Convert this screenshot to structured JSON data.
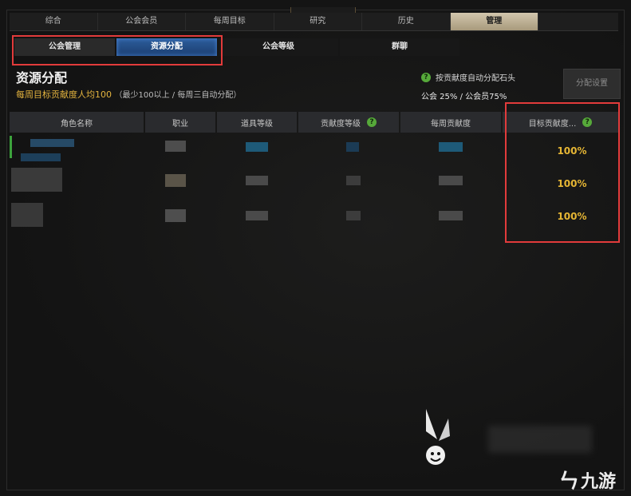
{
  "main_tabs": [
    {
      "label": "综合",
      "active": false
    },
    {
      "label": "公会会员",
      "active": false
    },
    {
      "label": "每周目标",
      "active": false
    },
    {
      "label": "研究",
      "active": false
    },
    {
      "label": "历史",
      "active": false
    },
    {
      "label": "管理",
      "active": true
    }
  ],
  "sub_tabs": [
    {
      "label": "公会管理",
      "active": false
    },
    {
      "label": "资源分配",
      "active": true
    },
    {
      "label": "公会等级",
      "active": false
    },
    {
      "label": "群聊",
      "active": false
    }
  ],
  "section": {
    "title": "资源分配",
    "subtitle": "每周目标贡献度人均100",
    "rule": "（最少100以上 / 每周三自动分配）"
  },
  "auto_distribute": {
    "label": "按贡献度自动分配石头",
    "guild_share": "公会 25%",
    "member_share": "公会员75%"
  },
  "allocate_button": "分配设置",
  "table": {
    "columns": [
      "角色名称",
      "职业",
      "道具等级",
      "贡献度等级",
      "每周贡献度",
      "目标贡献度..."
    ],
    "rows": [
      {
        "target": "100%"
      },
      {
        "target": "100%"
      },
      {
        "target": "100%"
      }
    ]
  },
  "brand": {
    "text": "九游",
    "mark": "ㄣ"
  },
  "colors": {
    "accent": "#e6b634",
    "highlight": "#e23b3b",
    "active_tab": "#2d5d9c"
  }
}
